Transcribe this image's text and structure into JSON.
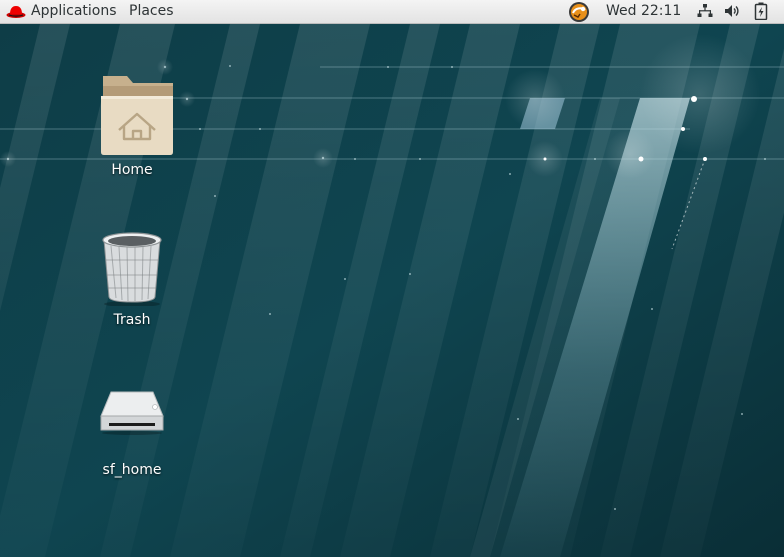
{
  "topbar": {
    "applications_label": "Applications",
    "places_label": "Places",
    "clock": "Wed 22:11",
    "icons": [
      "redhat-icon",
      "vm-status-icon",
      "network-icon",
      "volume-icon",
      "battery-icon"
    ]
  },
  "desktop": {
    "icons": [
      {
        "label": "Home",
        "icon": "home-folder-icon"
      },
      {
        "label": "Trash",
        "icon": "trash-icon"
      },
      {
        "label": "sf_home",
        "icon": "drive-icon"
      }
    ]
  },
  "colors": {
    "topbar_bg": "#ececec",
    "desktop_bg": "#0f3b44",
    "accent": "#cc0000"
  }
}
